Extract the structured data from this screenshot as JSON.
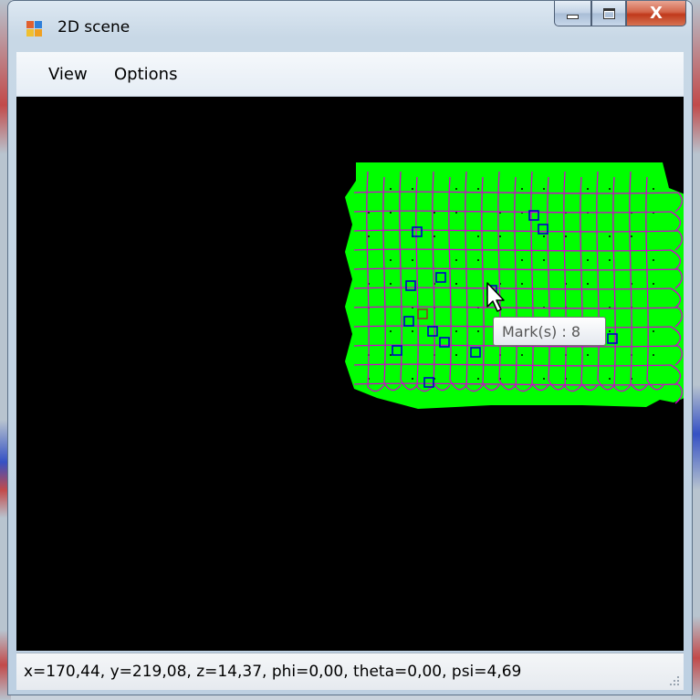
{
  "window": {
    "title": "2D scene"
  },
  "titlebar_buttons": {
    "minimize_icon": "minimize-icon",
    "maximize_icon": "maximize-icon",
    "close_label": "X"
  },
  "menu": {
    "items": [
      {
        "label": "View"
      },
      {
        "label": "Options"
      }
    ]
  },
  "scene": {
    "tooltip": "Mark(s) : 8",
    "colors": {
      "background": "#000000",
      "coverage": "#00ff00",
      "path": "#d000d0",
      "mark": "#0000c8",
      "selected_mark": "#8a3b2a"
    }
  },
  "status": {
    "text": "x=170,44, y=219,08, z=14,37, phi=0,00, theta=0,00, psi=4,69"
  }
}
